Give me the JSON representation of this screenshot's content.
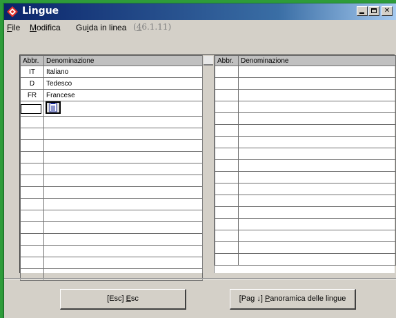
{
  "window": {
    "title": "Lingue"
  },
  "menu": {
    "file": {
      "acc": "F",
      "rest": "ile"
    },
    "modifica": {
      "acc": "M",
      "rest": "odifica"
    },
    "guida": {
      "pre": "Gu",
      "acc": "i",
      "rest": "da in linea"
    },
    "version": {
      "open": "(",
      "acc": "4",
      "rest": "6.1.11)"
    }
  },
  "table": {
    "headers": {
      "abbr": "Abbr.",
      "name": "Denominazione"
    },
    "rows": [
      {
        "abbr": "IT",
        "name": "Italiano"
      },
      {
        "abbr": "D",
        "name": "Tedesco"
      },
      {
        "abbr": "FR",
        "name": "Francese"
      }
    ]
  },
  "buttons": {
    "esc": {
      "prefix": "[Esc] ",
      "acc": "E",
      "rest": "sc"
    },
    "panoramica": {
      "prefix": "[Pag ↓] ",
      "acc": "P",
      "rest": "anoramica delle lingue"
    }
  }
}
